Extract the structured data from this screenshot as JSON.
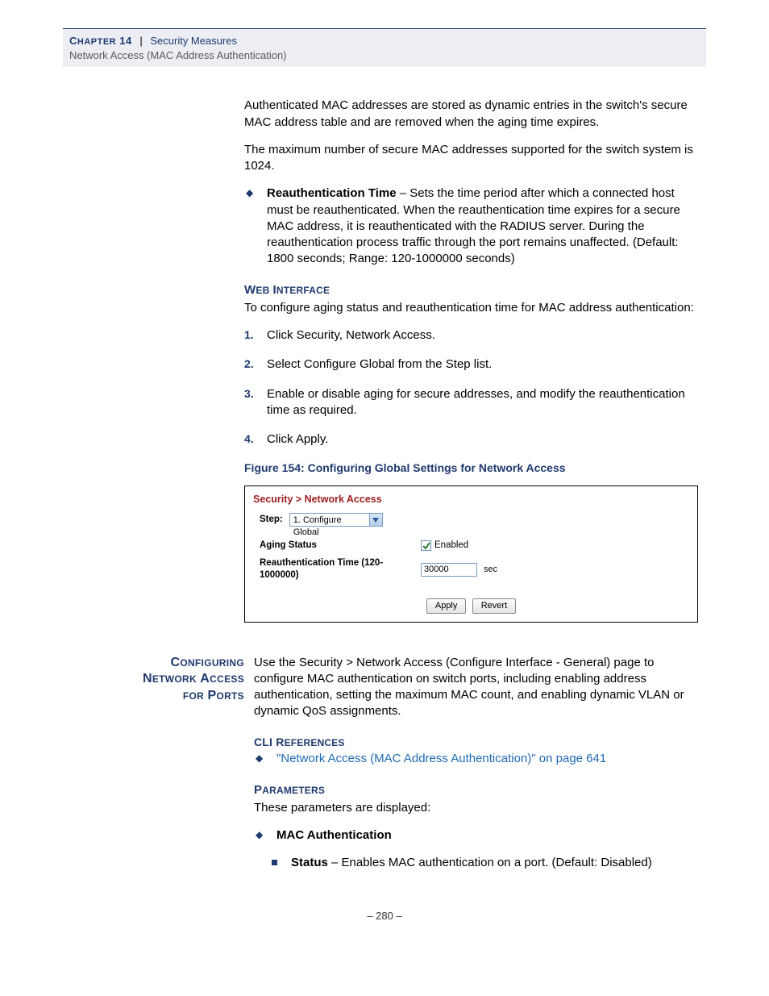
{
  "header": {
    "chapter_big": "C",
    "chapter_small": "HAPTER",
    "chapter_num": "14",
    "sep": "|",
    "title": "Security Measures",
    "subtitle": "Network Access (MAC Address Authentication)"
  },
  "intro": {
    "p1": "Authenticated MAC addresses are stored as dynamic entries in the switch's secure MAC address table and are removed when the aging time expires.",
    "p2": "The maximum number of secure MAC addresses supported for the switch system is 1024."
  },
  "reauth": {
    "bold": "Reauthentication Time",
    "text": " – Sets the time period after which a connected host must be reauthenticated. When the reauthentication time expires for a secure MAC address, it is reauthenticated with the RADIUS server. During the reauthentication process traffic through the port remains unaffected. (Default: 1800 seconds; Range: 120-1000000 seconds)"
  },
  "web_interface": {
    "heading_big1": "W",
    "heading_small1": "EB",
    "heading_big2": "I",
    "heading_small2": "NTERFACE",
    "intro": "To configure aging status and reauthentication time for MAC address authentication:",
    "steps": [
      "Click Security, Network Access.",
      "Select Configure Global from the Step list.",
      "Enable or disable aging for secure addresses, and modify the reauthentication time as required.",
      "Click Apply."
    ]
  },
  "figure": {
    "caption": "Figure 154:  Configuring Global Settings for Network Access",
    "title": "Security > Network Access",
    "step_label": "Step:",
    "step_value": "1. Configure Global",
    "aging_label": "Aging Status",
    "enabled_label": "Enabled",
    "reauth_label": "Reauthentication Time (120-1000000)",
    "reauth_value": "30000",
    "unit": "sec",
    "apply": "Apply",
    "revert": "Revert"
  },
  "ports_section": {
    "side_l1_b": "C",
    "side_l1_s": "ONFIGURING",
    "side_l2_b1": "N",
    "side_l2_s1": "ETWORK",
    "side_l2_b2": "A",
    "side_l2_s2": "CCESS",
    "side_l3_s1": "FOR",
    "side_l3_b": "P",
    "side_l3_s2": "ORTS",
    "body": "Use the Security > Network Access (Configure Interface - General) page to configure MAC authentication on switch ports, including enabling address authentication, setting the maximum MAC count, and enabling dynamic VLAN or dynamic QoS assignments.",
    "cli_head_b": "CLI R",
    "cli_head_s": "EFERENCES",
    "cli_link": "\"Network Access (MAC Address Authentication)\" on page 641",
    "param_head_b": "P",
    "param_head_s": "ARAMETERS",
    "param_intro": "These parameters are displayed:",
    "mac_auth": "MAC Authentication",
    "status_bold": "Status",
    "status_text": " – Enables MAC authentication on a port. (Default: Disabled)"
  },
  "page_num": "–  280  –"
}
